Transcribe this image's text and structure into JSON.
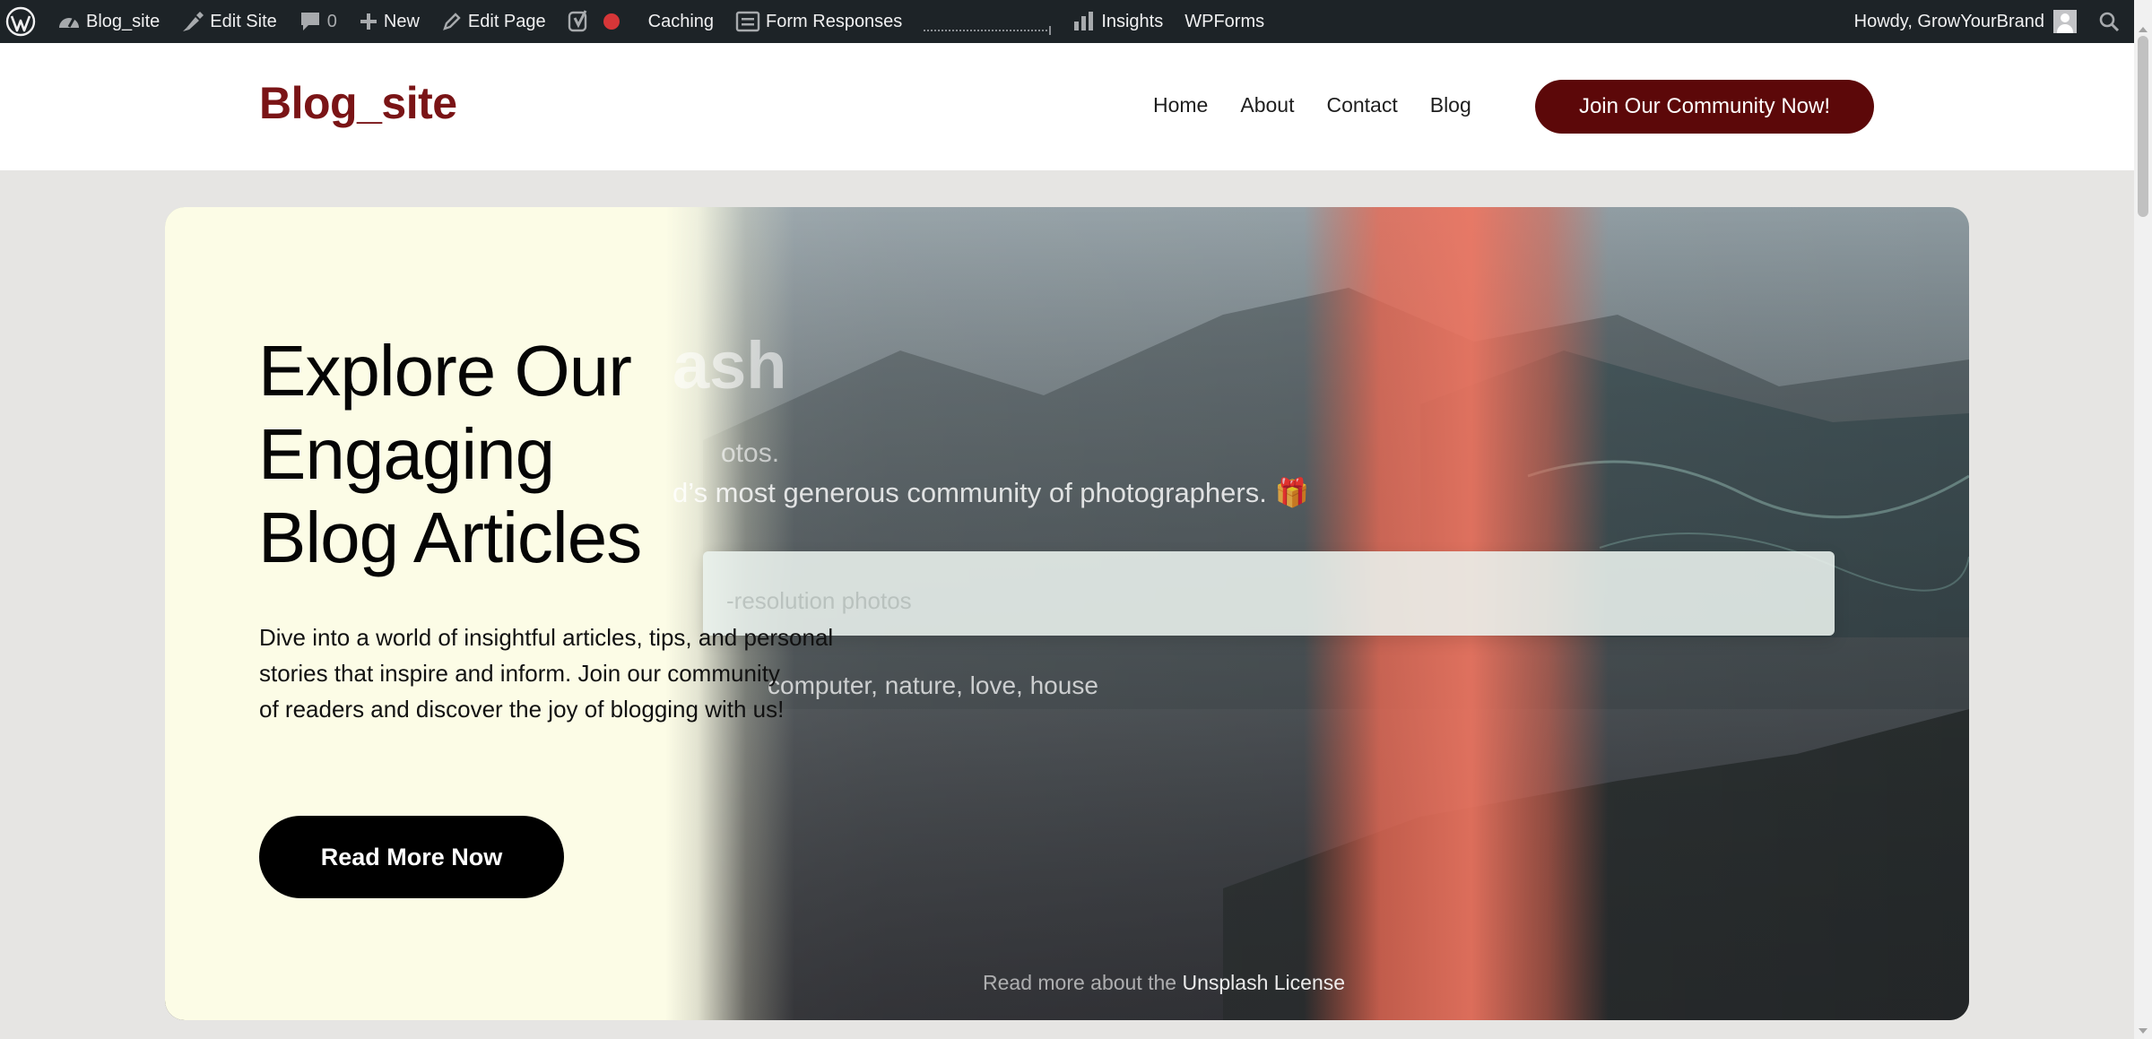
{
  "admin_bar": {
    "site_name": "Blog_site",
    "edit_site": "Edit Site",
    "comments_count": "0",
    "new_label": "New",
    "edit_page": "Edit Page",
    "caching": "Caching",
    "form_responses": "Form Responses",
    "insights": "Insights",
    "wpforms": "WPForms",
    "greeting": "Howdy, GrowYourBrand"
  },
  "header": {
    "site_title": "Blog_site",
    "nav": [
      "Home",
      "About",
      "Contact",
      "Blog"
    ],
    "cta_label": "Join Our Community Now!"
  },
  "hero": {
    "heading_lines": [
      "Explore Our",
      "Engaging",
      "Blog Articles"
    ],
    "description_lines": [
      "Dive into a world of insightful articles, tips, and personal",
      "stories that inspire and inform. Join our community",
      "of readers and discover the joy of blogging with us!"
    ],
    "button_label": "Read More Now",
    "background_overlay": {
      "brand_fragment": "ash",
      "line1_fragment": "otos.",
      "line2_fragment": "d’s most generous community of photographers. 🎁",
      "search_placeholder_fragment": "-resolution photos",
      "trending_fragment": "computer, nature, love, house",
      "license_prefix": "Read more about the",
      "license_link": "Unsplash License"
    }
  },
  "colors": {
    "admin_bar_bg": "#1d2327",
    "brand_red": "#7a1416",
    "cta_bg": "#5c0809",
    "page_bg": "#e6e5e3",
    "hero_cream": "#fcfce6"
  }
}
